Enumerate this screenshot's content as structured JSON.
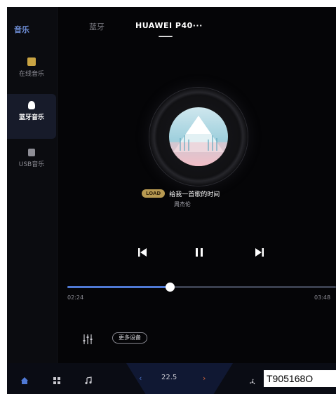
{
  "sidebar": {
    "title": "音乐",
    "items": [
      {
        "label": "在线音乐",
        "icon": "online-music-icon",
        "active": false
      },
      {
        "label": "蓝牙音乐",
        "icon": "bluetooth-music-icon",
        "active": true
      },
      {
        "label": "USB音乐",
        "icon": "usb-icon",
        "active": false
      }
    ]
  },
  "tabs": {
    "bluetooth": "蓝牙",
    "device": "HUAWEI P40···"
  },
  "track": {
    "badge": "LOAD",
    "title": "给我一首歌的时间",
    "artist": "周杰伦"
  },
  "progress": {
    "current": "02:24",
    "total": "03:48",
    "fraction": 0.38
  },
  "actions": {
    "more_devices": "更多设备"
  },
  "dock": {
    "temperature": "22.5",
    "left_arrow": "‹",
    "right_arrow": "›"
  },
  "overlay_code": "T905168O",
  "colors": {
    "accent": "#4f79d4",
    "badge": "#b89a52",
    "background": "#050507"
  }
}
